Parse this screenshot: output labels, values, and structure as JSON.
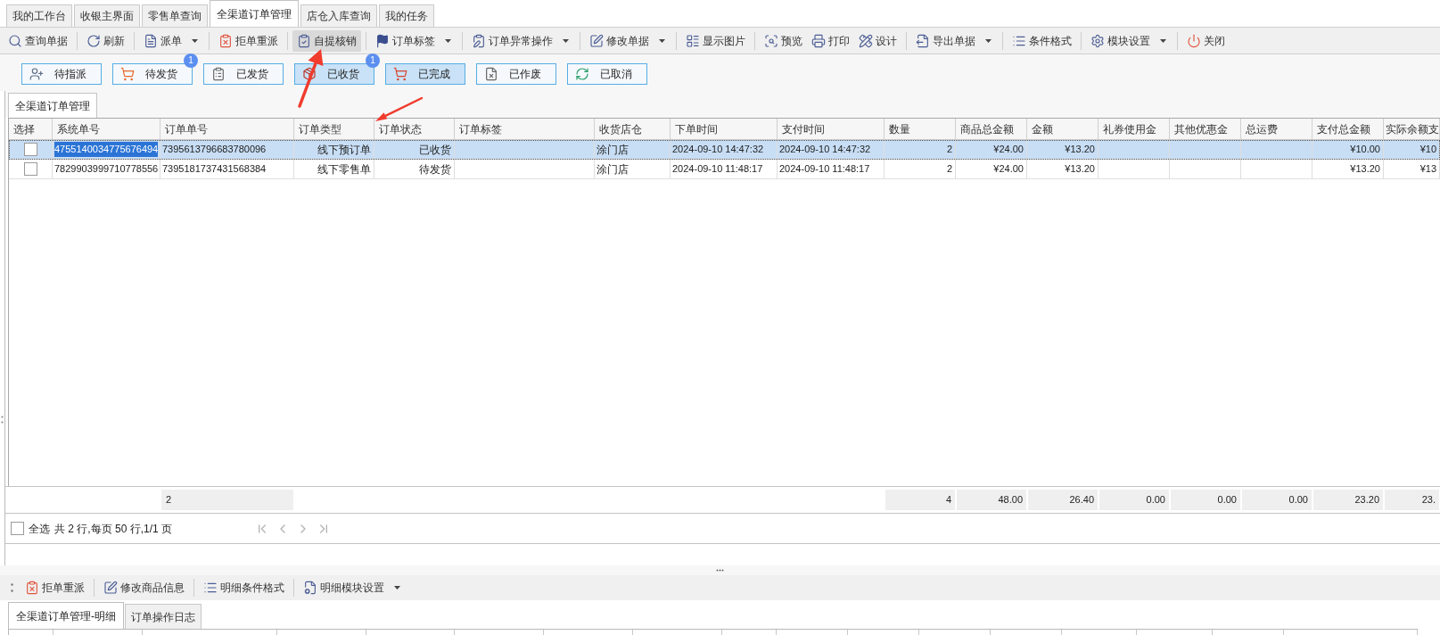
{
  "top_tabs": [
    {
      "label": "我的工作台",
      "selected": false
    },
    {
      "label": "收银主界面",
      "selected": false
    },
    {
      "label": "零售单查询",
      "selected": false
    },
    {
      "label": "全渠道订单管理",
      "selected": true
    },
    {
      "label": "店仓入库查询",
      "selected": false
    },
    {
      "label": "我的任务",
      "selected": false
    }
  ],
  "toolbar": [
    [
      {
        "label": "查询单据",
        "dropdown": false,
        "pressed": false
      }
    ],
    [
      {
        "label": "刷新",
        "dropdown": false,
        "pressed": false
      }
    ],
    [
      {
        "label": "派单",
        "dropdown": true,
        "pressed": false
      }
    ],
    [
      {
        "label": "拒单重派",
        "dropdown": false,
        "pressed": false
      }
    ],
    [
      {
        "label": "自提核销",
        "dropdown": false,
        "pressed": true
      }
    ],
    [
      {
        "label": "订单标签",
        "dropdown": true,
        "pressed": false
      }
    ],
    [
      {
        "label": "订单异常操作",
        "dropdown": true,
        "pressed": false
      }
    ],
    [
      {
        "label": "修改单据",
        "dropdown": true,
        "pressed": false
      }
    ],
    [
      {
        "label": "显示图片",
        "dropdown": false,
        "pressed": false
      }
    ],
    [
      {
        "label": "预览",
        "dropdown": false,
        "pressed": false
      },
      {
        "label": "打印",
        "dropdown": false,
        "pressed": false
      },
      {
        "label": "设计",
        "dropdown": false,
        "pressed": false
      }
    ],
    [
      {
        "label": "导出单据",
        "dropdown": true,
        "pressed": false
      }
    ],
    [
      {
        "label": "条件格式",
        "dropdown": false,
        "pressed": false
      }
    ],
    [
      {
        "label": "模块设置",
        "dropdown": true,
        "pressed": false
      }
    ],
    [
      {
        "label": "关闭",
        "dropdown": false,
        "pressed": false
      }
    ]
  ],
  "status_filters": [
    {
      "label": "待指派",
      "selected": false
    },
    {
      "label": "待发货",
      "selected": false,
      "badge": "1"
    },
    {
      "label": "已发货",
      "selected": false
    },
    {
      "label": "已收货",
      "selected": true,
      "badge": "1"
    },
    {
      "label": "已完成",
      "selected": true
    },
    {
      "label": "已作废",
      "selected": false
    },
    {
      "label": "已取消",
      "selected": false
    }
  ],
  "grid": {
    "tab": {
      "label": "全渠道订单管理",
      "selected": true
    },
    "columns": [
      {
        "label": "选择"
      },
      {
        "label": "系统单号"
      },
      {
        "label": "订单单号"
      },
      {
        "label": "订单类型"
      },
      {
        "label": "订单状态"
      },
      {
        "label": "订单标签"
      },
      {
        "label": "收货店仓"
      },
      {
        "label": "下单时间"
      },
      {
        "label": "支付时间"
      },
      {
        "label": "数量"
      },
      {
        "label": "商品总金额"
      },
      {
        "label": "金额"
      },
      {
        "label": "礼券使用金"
      },
      {
        "label": "其他优惠金"
      },
      {
        "label": "总运费"
      },
      {
        "label": "支付总金额"
      },
      {
        "label": "实际余额支"
      }
    ],
    "rows": [
      {
        "selected": true,
        "checked": false,
        "text_selected": true,
        "system_no": "4755140034775676494",
        "order_no": "7395613796683780096",
        "order_type": "线下预订单",
        "order_status": "已收货",
        "store": "涂门店",
        "order_time": "2024-09-10 14:47:32",
        "pay_time": "2024-09-10 14:47:32",
        "quantity": "2",
        "goods_total": "¥24.00",
        "amount": "¥13.20",
        "pay_total": "¥10.00",
        "balance_pay": "¥10"
      },
      {
        "selected": false,
        "checked": false,
        "text_selected": false,
        "system_no": "7829903999710778556",
        "order_no": "7395181737431568384",
        "order_type": "线下零售单",
        "order_status": "待发货",
        "store": "涂门店",
        "order_time": "2024-09-10 11:48:17",
        "pay_time": "2024-09-10 11:48:17",
        "quantity": "2",
        "goods_total": "¥24.00",
        "amount": "¥13.20",
        "pay_total": "¥13.20",
        "balance_pay": "¥13"
      }
    ],
    "totals": {
      "order_no": "2",
      "quantity": "4",
      "goods_total": "48.00",
      "amount": "26.40",
      "coupon": "0.00",
      "other_discount": "0.00",
      "freight": "0.00",
      "pay_total": "23.20",
      "balance_pay": "23."
    }
  },
  "pagination": {
    "select_all": {
      "label": "全选",
      "checked": false
    },
    "info": "共 2 行,每页 50 行,1/1 页",
    "nav_disabled": true
  },
  "detail_toolbar": [
    {
      "label": "拒单重派",
      "dropdown": false
    },
    {
      "label": "修改商品信息",
      "dropdown": false
    },
    {
      "label": "明细条件格式",
      "dropdown": false
    },
    {
      "label": "明细模块设置",
      "dropdown": true
    }
  ],
  "detail_tabs": [
    {
      "label": "全渠道订单管理-明细",
      "selected": true
    },
    {
      "label": "订单操作日志",
      "selected": false
    }
  ]
}
